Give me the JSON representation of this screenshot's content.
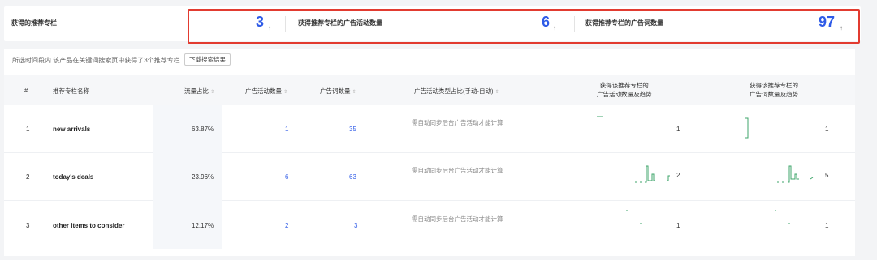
{
  "summary": {
    "label": "获得的推荐专栏",
    "count": "3",
    "campaign_label": "获得推荐专栏的广告活动数量",
    "campaign_count": "6",
    "keyword_label": "获得推荐专栏的广告词数量",
    "keyword_count": "97",
    "arrow": "↑"
  },
  "info_text": "所选时间段内 该产品在关键词搜索页中获得了3个推荐专栏",
  "download_label": "下载搜索结果",
  "columns": {
    "index": "#",
    "name": "推荐专栏名称",
    "flow": "流量占比",
    "campaigns": "广告活动数量",
    "keywords": "广告词数量",
    "type_ratio": "广告活动类型占比(手动-自动)",
    "campaign_trend_1": "获得该推荐专栏的",
    "campaign_trend_2": "广告活动数量及趋势",
    "keyword_trend_1": "获得该推荐专栏的",
    "keyword_trend_2": "广告词数量及趋势",
    "sort_glyph": "⇕"
  },
  "rows": [
    {
      "index": "1",
      "name": "new arrivals",
      "flow": "63.87%",
      "campaigns": "1",
      "keywords": "35",
      "type_hint": "需自动同步后台广告活动才能计算",
      "campaign_trend_value": "1",
      "keyword_trend_value": "1"
    },
    {
      "index": "2",
      "name": "today's deals",
      "flow": "23.96%",
      "campaigns": "6",
      "keywords": "63",
      "type_hint": "需自动同步后台广告活动才能计算",
      "campaign_trend_value": "2",
      "keyword_trend_value": "5"
    },
    {
      "index": "3",
      "name": "other items to consider",
      "flow": "12.17%",
      "campaigns": "2",
      "keywords": "3",
      "type_hint": "需自动同步后台广告活动才能计算",
      "campaign_trend_value": "1",
      "keyword_trend_value": "1"
    }
  ],
  "colors": {
    "accent": "#2f5be7",
    "highlight_border": "#e23b30",
    "sparkline": "#3fa66b"
  }
}
